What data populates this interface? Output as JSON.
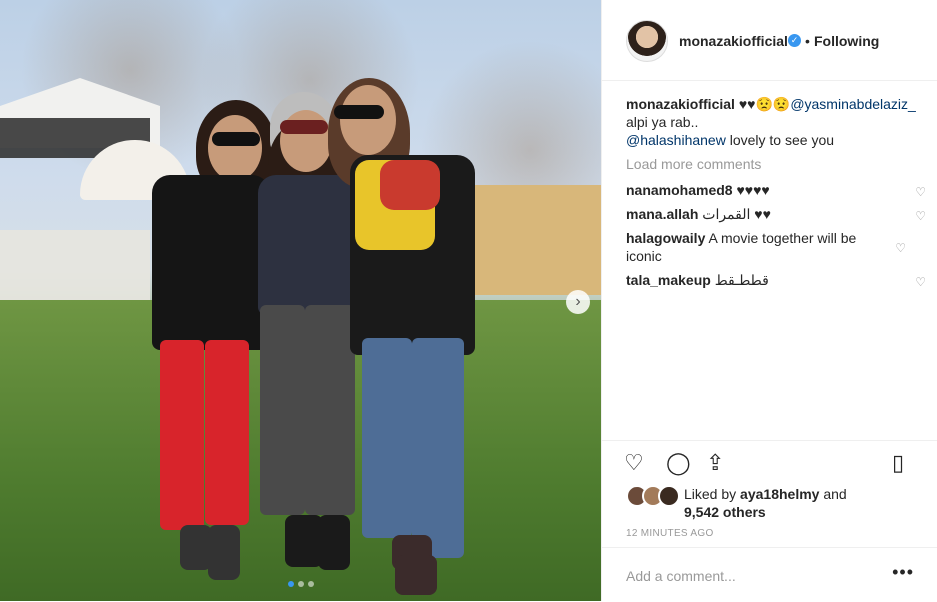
{
  "post": {
    "username": "monazakiofficial",
    "follow_status": "Following",
    "separator": "•"
  },
  "caption": {
    "username": "monazakiofficial",
    "emojis": "♥♥😟😟",
    "mention1": "@yasminabdelaziz_",
    "line2": "alpi ya rab..",
    "mention2": "@halashihanew",
    "line3_rest": " lovely to see you"
  },
  "load_more": "Load more comments",
  "comments": [
    {
      "username": "nanamohamed8",
      "text": "♥♥♥♥"
    },
    {
      "username": "mana.allah",
      "text": "القمرات ♥♥"
    },
    {
      "username": "halagowaily",
      "text": "A movie together will be iconic"
    },
    {
      "username": "tala_makeup",
      "text": "قططـقط"
    }
  ],
  "likes": {
    "prefix": "Liked by",
    "user": "aya18helmy",
    "and": "and",
    "others": "9,542 others"
  },
  "timestamp": "12 MINUTES AGO",
  "add_comment_placeholder": "Add a comment...",
  "more_glyph": "•••",
  "icons": {
    "like": "heart-icon",
    "comment": "comment-icon",
    "share": "share-icon",
    "save": "bookmark-icon",
    "verified": "verified-badge-icon",
    "next": "chevron-right-icon"
  },
  "colors": {
    "accent": "#3897f0",
    "mention": "#003569",
    "muted": "#999999"
  }
}
